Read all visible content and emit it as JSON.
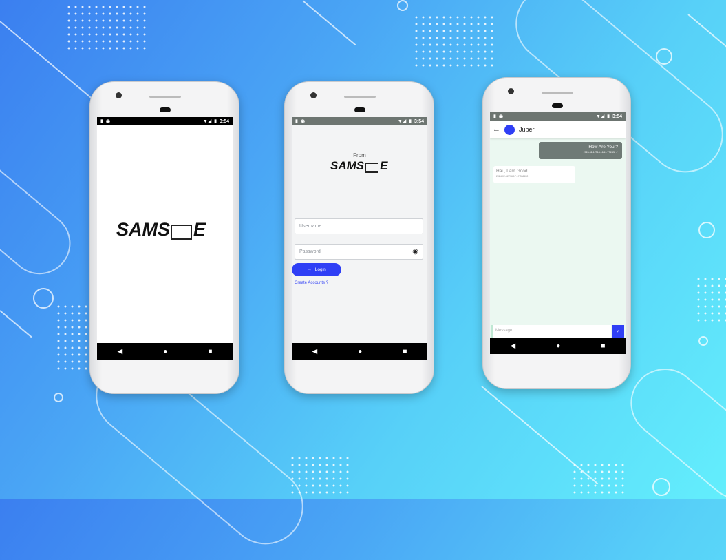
{
  "status_bar": {
    "time": "3:54"
  },
  "splash": {
    "logo_left": "SAMS",
    "logo_right": "E"
  },
  "login": {
    "from_label": "From",
    "logo_left": "SAMS",
    "logo_right": "E",
    "username_placeholder": "Username",
    "password_placeholder": "Password",
    "login_button": "Login",
    "create_account_link": "Create Accounts ?",
    "accent": "#2f3ff5"
  },
  "chat": {
    "contact_name": "Juber",
    "messages": [
      {
        "text": "How Are You ?",
        "timestamp": "2024-02-12T14:16:41.774922",
        "direction": "sent"
      },
      {
        "text": "Hai , I am Good",
        "timestamp": "2024-02-12T16:17:17.356452",
        "direction": "received"
      }
    ],
    "message_placeholder": "Message",
    "send_icon": "send-icon"
  },
  "nav": {
    "back": "◀",
    "home": "●",
    "recents": "■"
  }
}
